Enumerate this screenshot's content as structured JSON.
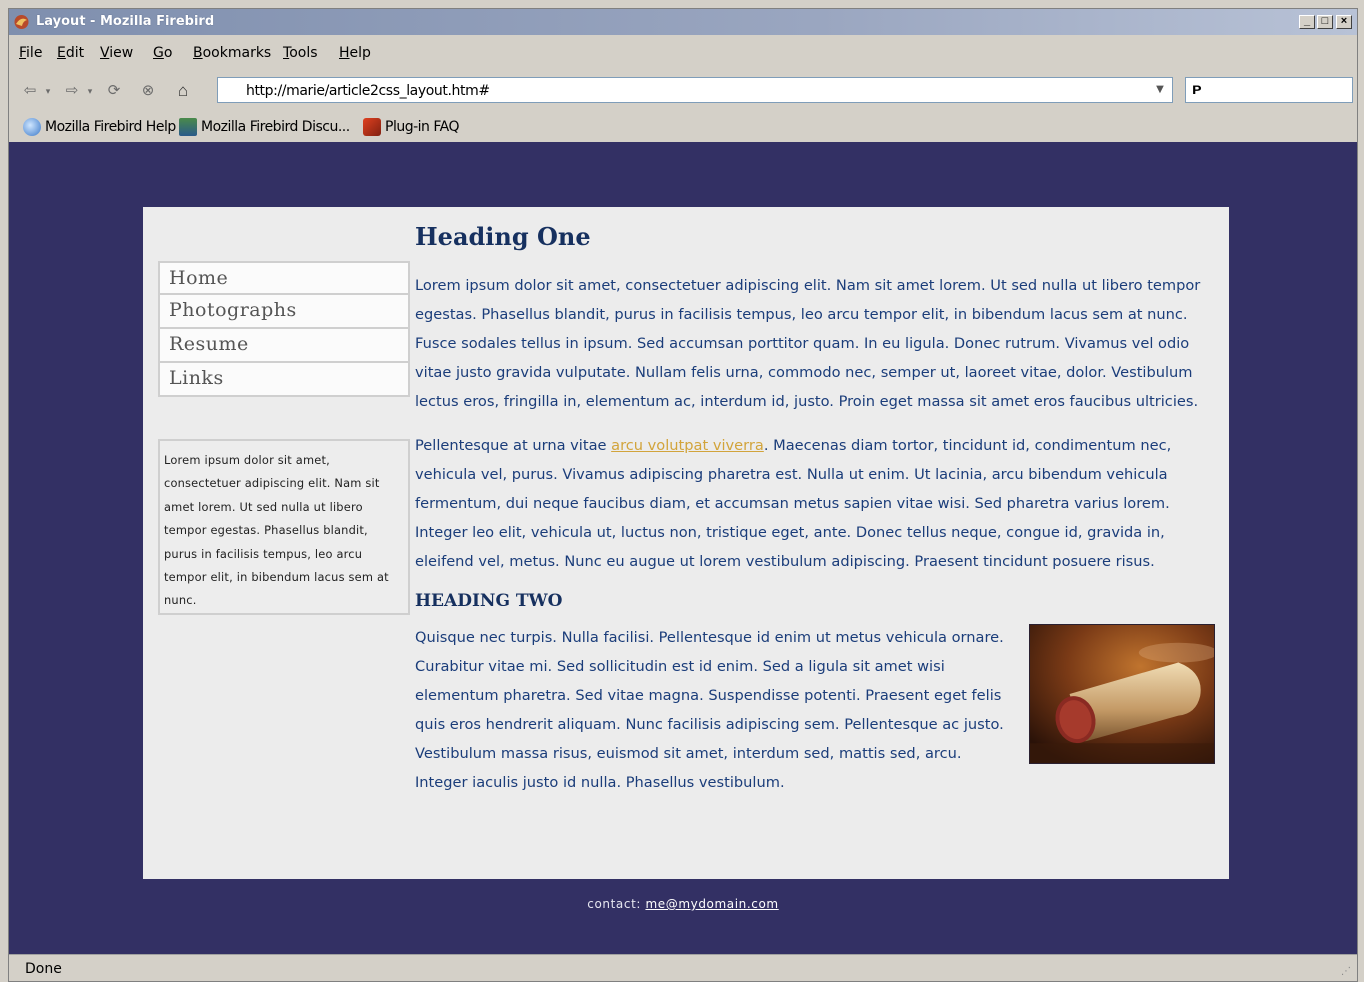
{
  "window": {
    "title": "Layout - Mozilla Firebird",
    "minimize": "_",
    "maximize": "□",
    "close": "×"
  },
  "menu": [
    "File",
    "Edit",
    "View",
    "Go",
    "Bookmarks",
    "Tools",
    "Help"
  ],
  "navigation": {
    "back_icon": "⇦",
    "forward_icon": "⇨",
    "reload_icon": "⟳",
    "stop_icon": "⊗",
    "home_icon": "⌂",
    "url": "http://marie/article2css_layout.htm#",
    "dropdown_icon": "▼",
    "search_icon": "ᴘ"
  },
  "bookmarks": [
    "Mozilla Firebird Help",
    "Mozilla Firebird Discu...",
    "Plug-in FAQ"
  ],
  "page": {
    "nav": [
      "Home",
      "Photographs",
      "Resume",
      "Links"
    ],
    "sidebar_text": "Lorem ipsum dolor sit amet, consectetuer adipiscing elit. Nam sit amet lorem. Ut sed nulla ut libero tempor egestas. Phasellus blandit, purus in facilisis tempus, leo arcu tempor elit, in bibendum lacus sem at nunc.",
    "heading_one": "Heading One",
    "para1": "Lorem ipsum dolor sit amet, consectetuer adipiscing elit. Nam sit amet lorem. Ut sed nulla ut libero tempor egestas. Phasellus blandit, purus in facilisis tempus, leo arcu tempor elit, in bibendum lacus sem at nunc. Fusce sodales tellus in ipsum. Sed accumsan porttitor quam. In eu ligula. Donec rutrum. Vivamus vel odio vitae justo gravida vulputate. Nullam felis urna, commodo nec, semper ut, laoreet vitae, dolor. Vestibulum lectus eros, fringilla in, elementum ac, interdum id, justo. Proin eget massa sit amet eros faucibus ultricies.",
    "para2_before": "Pellentesque at urna vitae ",
    "para2_link": "arcu volutpat viverra",
    "para2_after": ". Maecenas diam tortor, tincidunt id, condimentum nec, vehicula vel, purus. Vivamus adipiscing pharetra est. Nulla ut enim. Ut lacinia, arcu bibendum vehicula fermentum, dui neque faucibus diam, et accumsan metus sapien vitae wisi. Sed pharetra varius lorem. Integer leo elit, vehicula ut, luctus non, tristique eget, ante. Donec tellus neque, congue id, gravida in, eleifend vel, metus. Nunc eu augue ut lorem vestibulum adipiscing. Praesent tincidunt posuere risus.",
    "heading_two": "HEADING TWO",
    "para3": "Quisque nec turpis. Nulla facilisi. Pellentesque id enim ut metus vehicula ornare. Curabitur vitae mi. Sed sollicitudin est id enim. Sed a ligula sit amet wisi elementum pharetra. Sed vitae magna. Suspendisse potenti. Praesent eget felis quis eros hendrerit aliquam. Nunc facilisis adipiscing sem. Pellentesque ac justo. Vestibulum massa risus, euismod sit amet, interdum sed, mattis sed, arcu. Integer iaculis justo id nulla. Phasellus vestibulum.",
    "footer_label": "contact: ",
    "footer_email": "me@mydomain.com"
  },
  "status": "Done"
}
